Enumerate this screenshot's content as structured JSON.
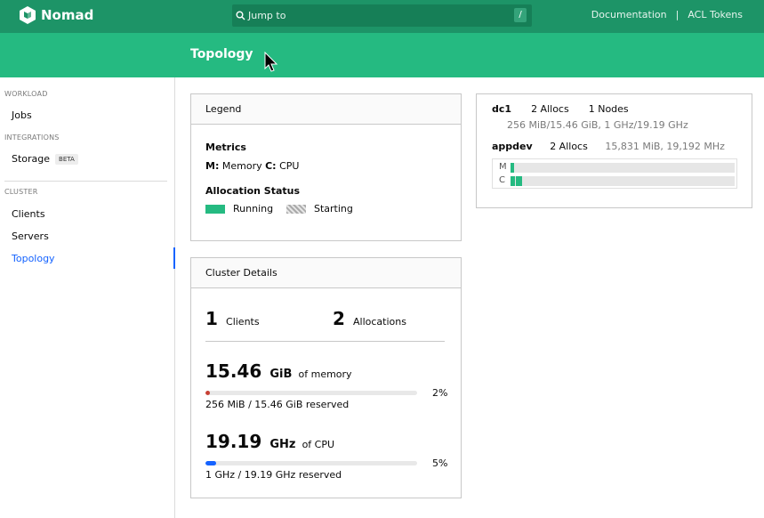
{
  "app": {
    "name": "Nomad"
  },
  "search": {
    "placeholder": "Jump to",
    "shortcut": "/"
  },
  "toplinks": {
    "documentation": "Documentation",
    "separator": "|",
    "acl_tokens": "ACL Tokens"
  },
  "page": {
    "title": "Topology"
  },
  "sidebar": {
    "sections": [
      {
        "label": "WORKLOAD"
      },
      {
        "label": "INTEGRATIONS"
      },
      {
        "label": "CLUSTER"
      }
    ],
    "items": [
      {
        "label": "Jobs"
      },
      {
        "label": "Storage",
        "badge": "BETA"
      },
      {
        "label": "Clients"
      },
      {
        "label": "Servers"
      },
      {
        "label": "Topology"
      }
    ]
  },
  "legend": {
    "title": "Legend",
    "metrics_title": "Metrics",
    "metrics": [
      {
        "key": "M:",
        "label": "Memory"
      },
      {
        "key": "C:",
        "label": "CPU"
      }
    ],
    "alloc_status_title": "Allocation Status",
    "statuses": [
      {
        "label": "Running"
      },
      {
        "label": "Starting"
      }
    ]
  },
  "cluster": {
    "title": "Cluster Details",
    "clients_count": "1",
    "clients_label": "Clients",
    "allocations_count": "2",
    "allocations_label": "Allocations",
    "memory": {
      "value": "15.46",
      "unit": "GiB",
      "suffix": "of memory",
      "percent_label": "2%",
      "percent": 2,
      "reserved": "256 MiB / 15.46 GiB reserved"
    },
    "cpu": {
      "value": "19.19",
      "unit": "GHz",
      "suffix": "of CPU",
      "percent_label": "5%",
      "percent": 5,
      "reserved": "1 GHz / 19.19 GHz reserved"
    }
  },
  "datacenter": {
    "name": "dc1",
    "allocs": "2 Allocs",
    "nodes": "1 Nodes",
    "summary": "256 MiB/15.46 GiB, 1 GHz/19.19 GHz",
    "node": {
      "name": "appdev",
      "allocs": "2 Allocs",
      "resources": "15,831 MiB, 19,192 MHz",
      "mem_label": "M",
      "cpu_label": "C"
    }
  },
  "colors": {
    "brand": "#1d9467",
    "running": "#25ba81",
    "memory_fill": "#c84034",
    "cpu_fill": "#1563ff",
    "active": "#1563ff"
  }
}
